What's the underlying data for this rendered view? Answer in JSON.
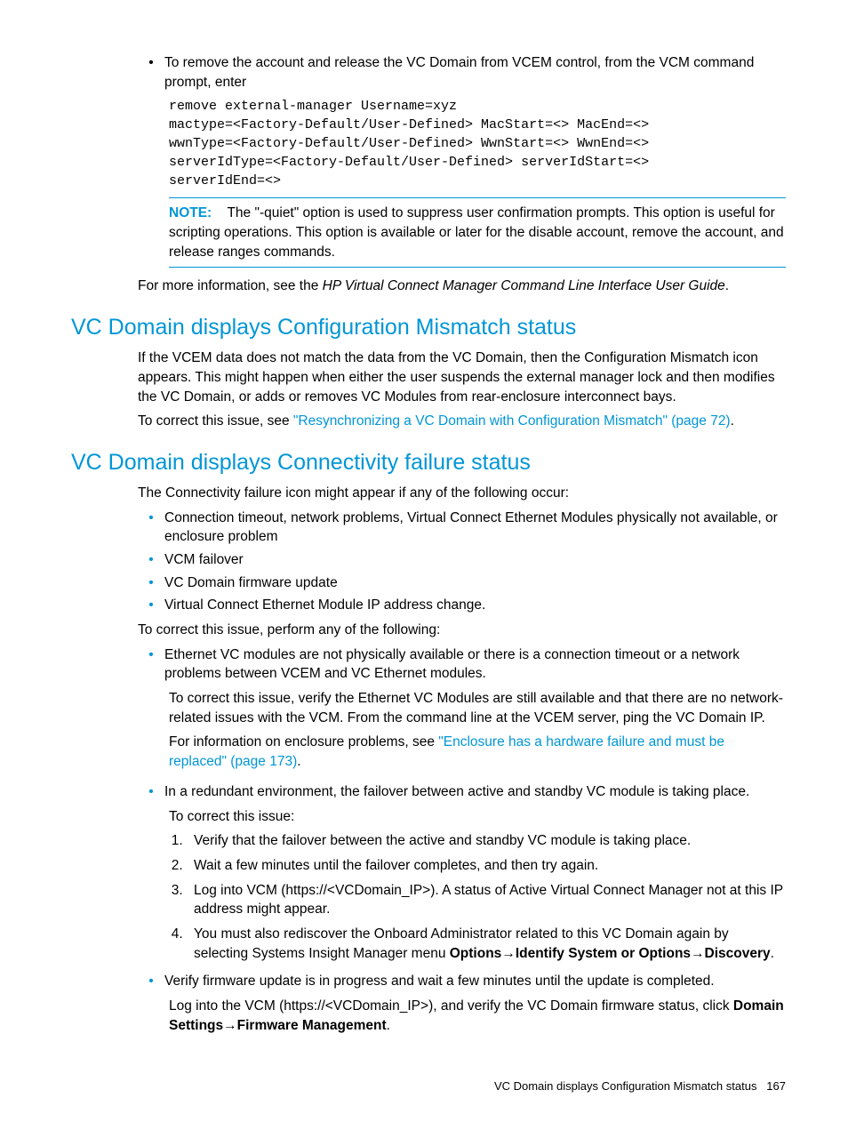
{
  "intro": {
    "bullet1": "To remove the account and release the VC Domain from VCEM control, from the VCM command prompt, enter",
    "code": "remove external-manager Username=xyz\nmactype=<Factory-Default/User-Defined> MacStart=<> MacEnd=<>\nwwnType=<Factory-Default/User-Defined> WwnStart=<> WwnEnd=<>\nserverIdType=<Factory-Default/User-Defined> serverIdStart=<>\nserverIdEnd=<>",
    "note_label": "NOTE:",
    "note_text": "The \"-quiet\" option is used to suppress user confirmation prompts. This option is useful for scripting operations. This option is available or later for the disable account, remove the account, and release ranges commands.",
    "more_info_pre": "For more information, see the ",
    "more_info_italic": "HP Virtual Connect Manager Command Line Interface User Guide",
    "more_info_post": "."
  },
  "section1": {
    "heading": "VC Domain displays Configuration Mismatch status",
    "para1": "If the VCEM data does not match the data from the VC Domain, then the Configuration Mismatch icon appears. This might happen when either the user suspends the external manager lock and then modifies the VC Domain, or adds or removes VC Modules from rear-enclosure interconnect bays.",
    "para2_pre": "To correct this issue, see ",
    "para2_link": "\"Resynchronizing a VC Domain with Configuration Mismatch\" (page 72)",
    "para2_post": "."
  },
  "section2": {
    "heading": "VC Domain displays Connectivity failure status",
    "intro": "The Connectivity failure icon might appear if any of the following occur:",
    "causes": [
      "Connection timeout, network problems, Virtual Connect Ethernet Modules physically not available, or enclosure problem",
      "VCM failover",
      "VC Domain firmware update",
      "Virtual Connect Ethernet Module IP address change."
    ],
    "correct_intro": "To correct this issue, perform any of the following:",
    "fix1": {
      "main": "Ethernet VC modules are not physically available or there is a connection timeout or a network problems between VCEM and VC Ethernet modules.",
      "sub1": "To correct this issue, verify the Ethernet VC Modules are still available and that there are no network-related issues with the VCM. From the command line at the VCEM server, ping the VC Domain IP.",
      "sub2_pre": "For information on enclosure problems, see ",
      "sub2_link": "\"Enclosure has a hardware failure and must be replaced\" (page 173)",
      "sub2_post": "."
    },
    "fix2": {
      "main": "In a redundant environment, the failover between active and standby VC module is taking place.",
      "sub1": "To correct this issue:",
      "steps": [
        "Verify that the failover between the active and standby VC module is taking place.",
        "Wait a few minutes until the failover completes, and then try again.",
        "Log into VCM (https://<VCDomain_IP>). A status of Active Virtual Connect Manager not at this IP address might appear."
      ],
      "step4_pre": "You must also rediscover the Onboard Administrator related to this VC Domain again by selecting Systems Insight Manager menu ",
      "step4_bold1": "Options",
      "step4_arrow": "→",
      "step4_bold2": "Identify System or Options",
      "step4_bold3": "Discovery",
      "step4_post": "."
    },
    "fix3": {
      "main": "Verify firmware update is in progress and wait a few minutes until the update is completed.",
      "sub1_pre": "Log into the VCM (https://<VCDomain_IP>), and verify the VC Domain firmware status, click ",
      "sub1_bold1": "Domain Settings",
      "sub1_arrow": "→",
      "sub1_bold2": "Firmware Management",
      "sub1_post": "."
    }
  },
  "footer": {
    "text": "VC Domain displays Configuration Mismatch status",
    "page": "167"
  }
}
